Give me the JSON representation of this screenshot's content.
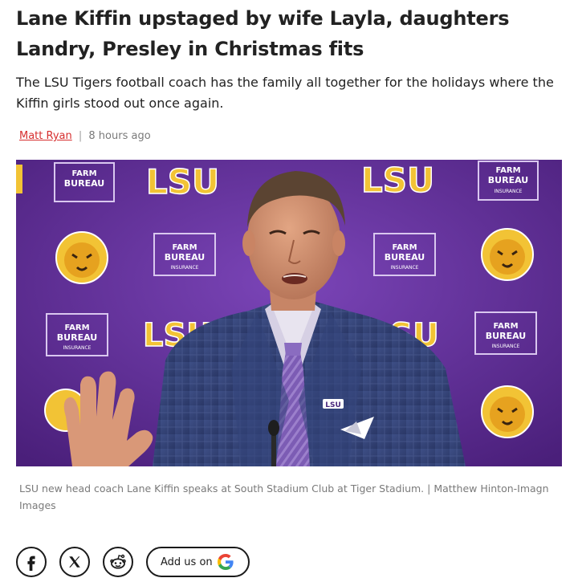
{
  "article": {
    "headline": "Lane Kiffin upstaged by wife Layla, daughters Landry, Presley in Christmas fits",
    "dek": "The LSU Tigers football coach has the family all together for the holidays where the Kiffin girls stood out once again.",
    "author": "Matt Ryan",
    "separator": "|",
    "timestamp": "8 hours ago"
  },
  "photo": {
    "backdrop_text": "LSU",
    "sponsor_line1": "FARM",
    "sponsor_line2": "BUREAU",
    "sponsor_line3": "INSURANCE",
    "podium_logo": "LSU",
    "caption": "LSU new head coach Lane Kiffin speaks at South Stadium Club at Tiger Stadium. | Matthew Hinton-Imagn Images"
  },
  "share": {
    "icons": [
      "facebook-icon",
      "x-icon",
      "reddit-icon"
    ],
    "google_label": "Add us on",
    "google_icon": "google-g-icon"
  },
  "colors": {
    "author_link": "#d62e2e",
    "backdrop_purple": "#5a2d8e",
    "lsu_gold": "#f2c335"
  }
}
